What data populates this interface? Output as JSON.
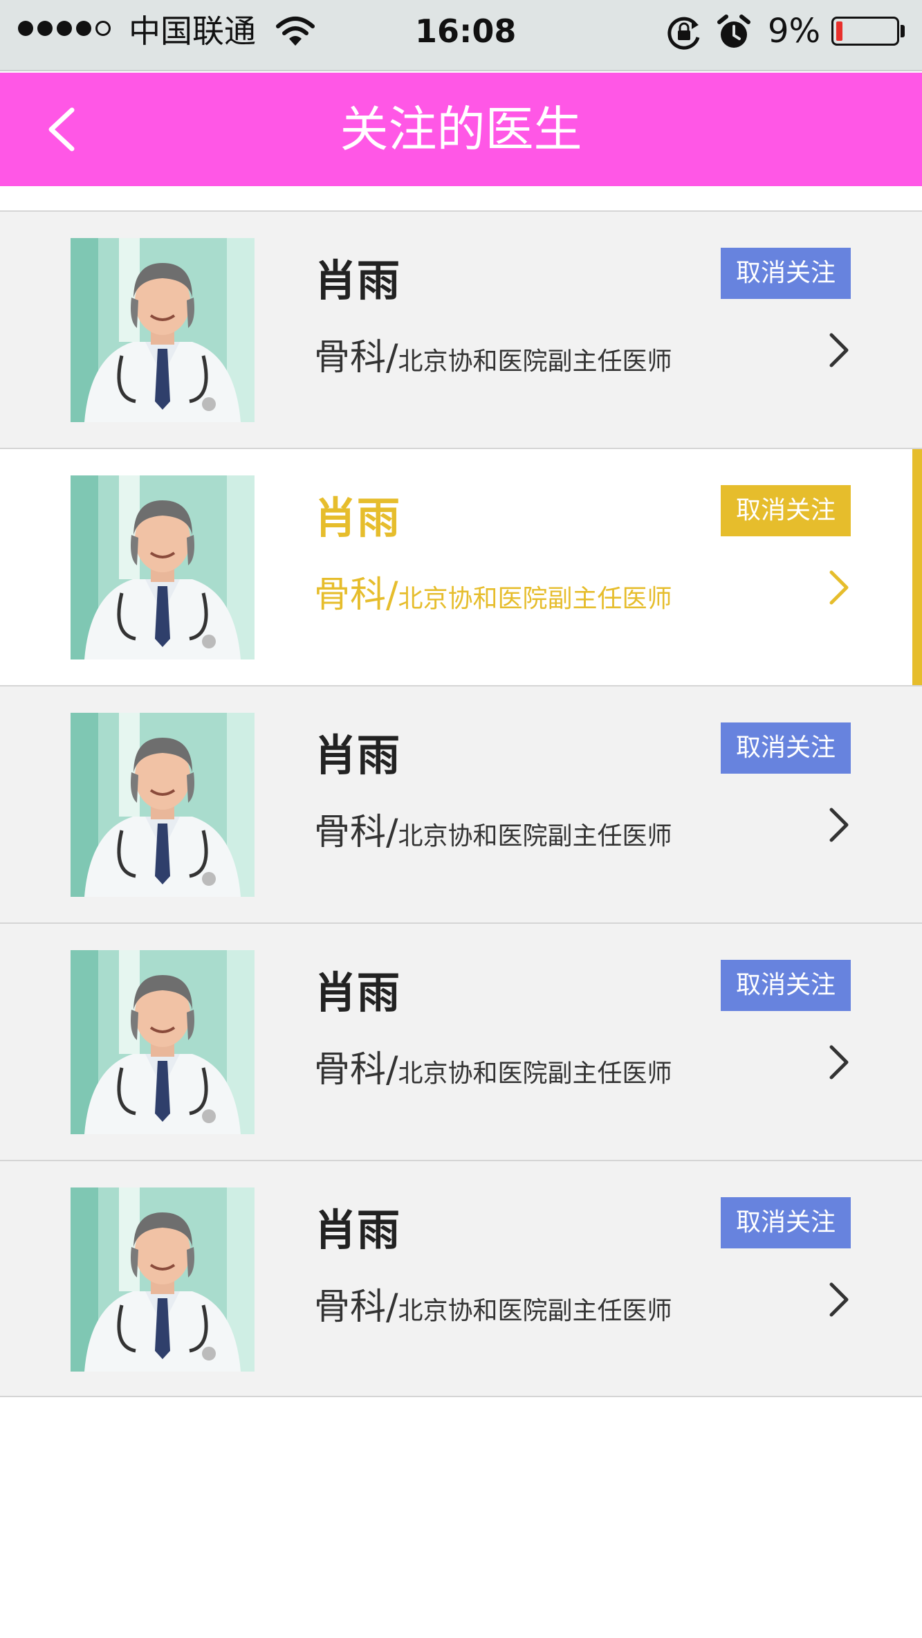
{
  "status_bar": {
    "carrier": "中国联通",
    "time": "16:08",
    "battery": "9%",
    "battery_level": 0.09,
    "signal_bars": 4,
    "signal_total": 5,
    "icons": [
      "signal-icon",
      "wifi-icon",
      "rotation-lock-icon",
      "alarm-icon",
      "battery-icon"
    ]
  },
  "nav": {
    "title": "关注的医生",
    "back_icon": "chevron-left-icon"
  },
  "colors": {
    "nav_bg": "#ff57e6",
    "button_blue": "#6783de",
    "accent_yellow": "#e6bd2c",
    "row_bg": "#f2f2f2"
  },
  "doctors": [
    {
      "name": "肖雨",
      "department": "骨科",
      "separator": "/",
      "title": "北京协和医院副主任医师",
      "action": "取消关注",
      "selected": false
    },
    {
      "name": "肖雨",
      "department": "骨科",
      "separator": "/",
      "title": "北京协和医院副主任医师",
      "action": "取消关注",
      "selected": true
    },
    {
      "name": "肖雨",
      "department": "骨科",
      "separator": "/",
      "title": "北京协和医院副主任医师",
      "action": "取消关注",
      "selected": false
    },
    {
      "name": "肖雨",
      "department": "骨科",
      "separator": "/",
      "title": "北京协和医院副主任医师",
      "action": "取消关注",
      "selected": false
    },
    {
      "name": "肖雨",
      "department": "骨科",
      "separator": "/",
      "title": "北京协和医院副主任医师",
      "action": "取消关注",
      "selected": false
    }
  ]
}
